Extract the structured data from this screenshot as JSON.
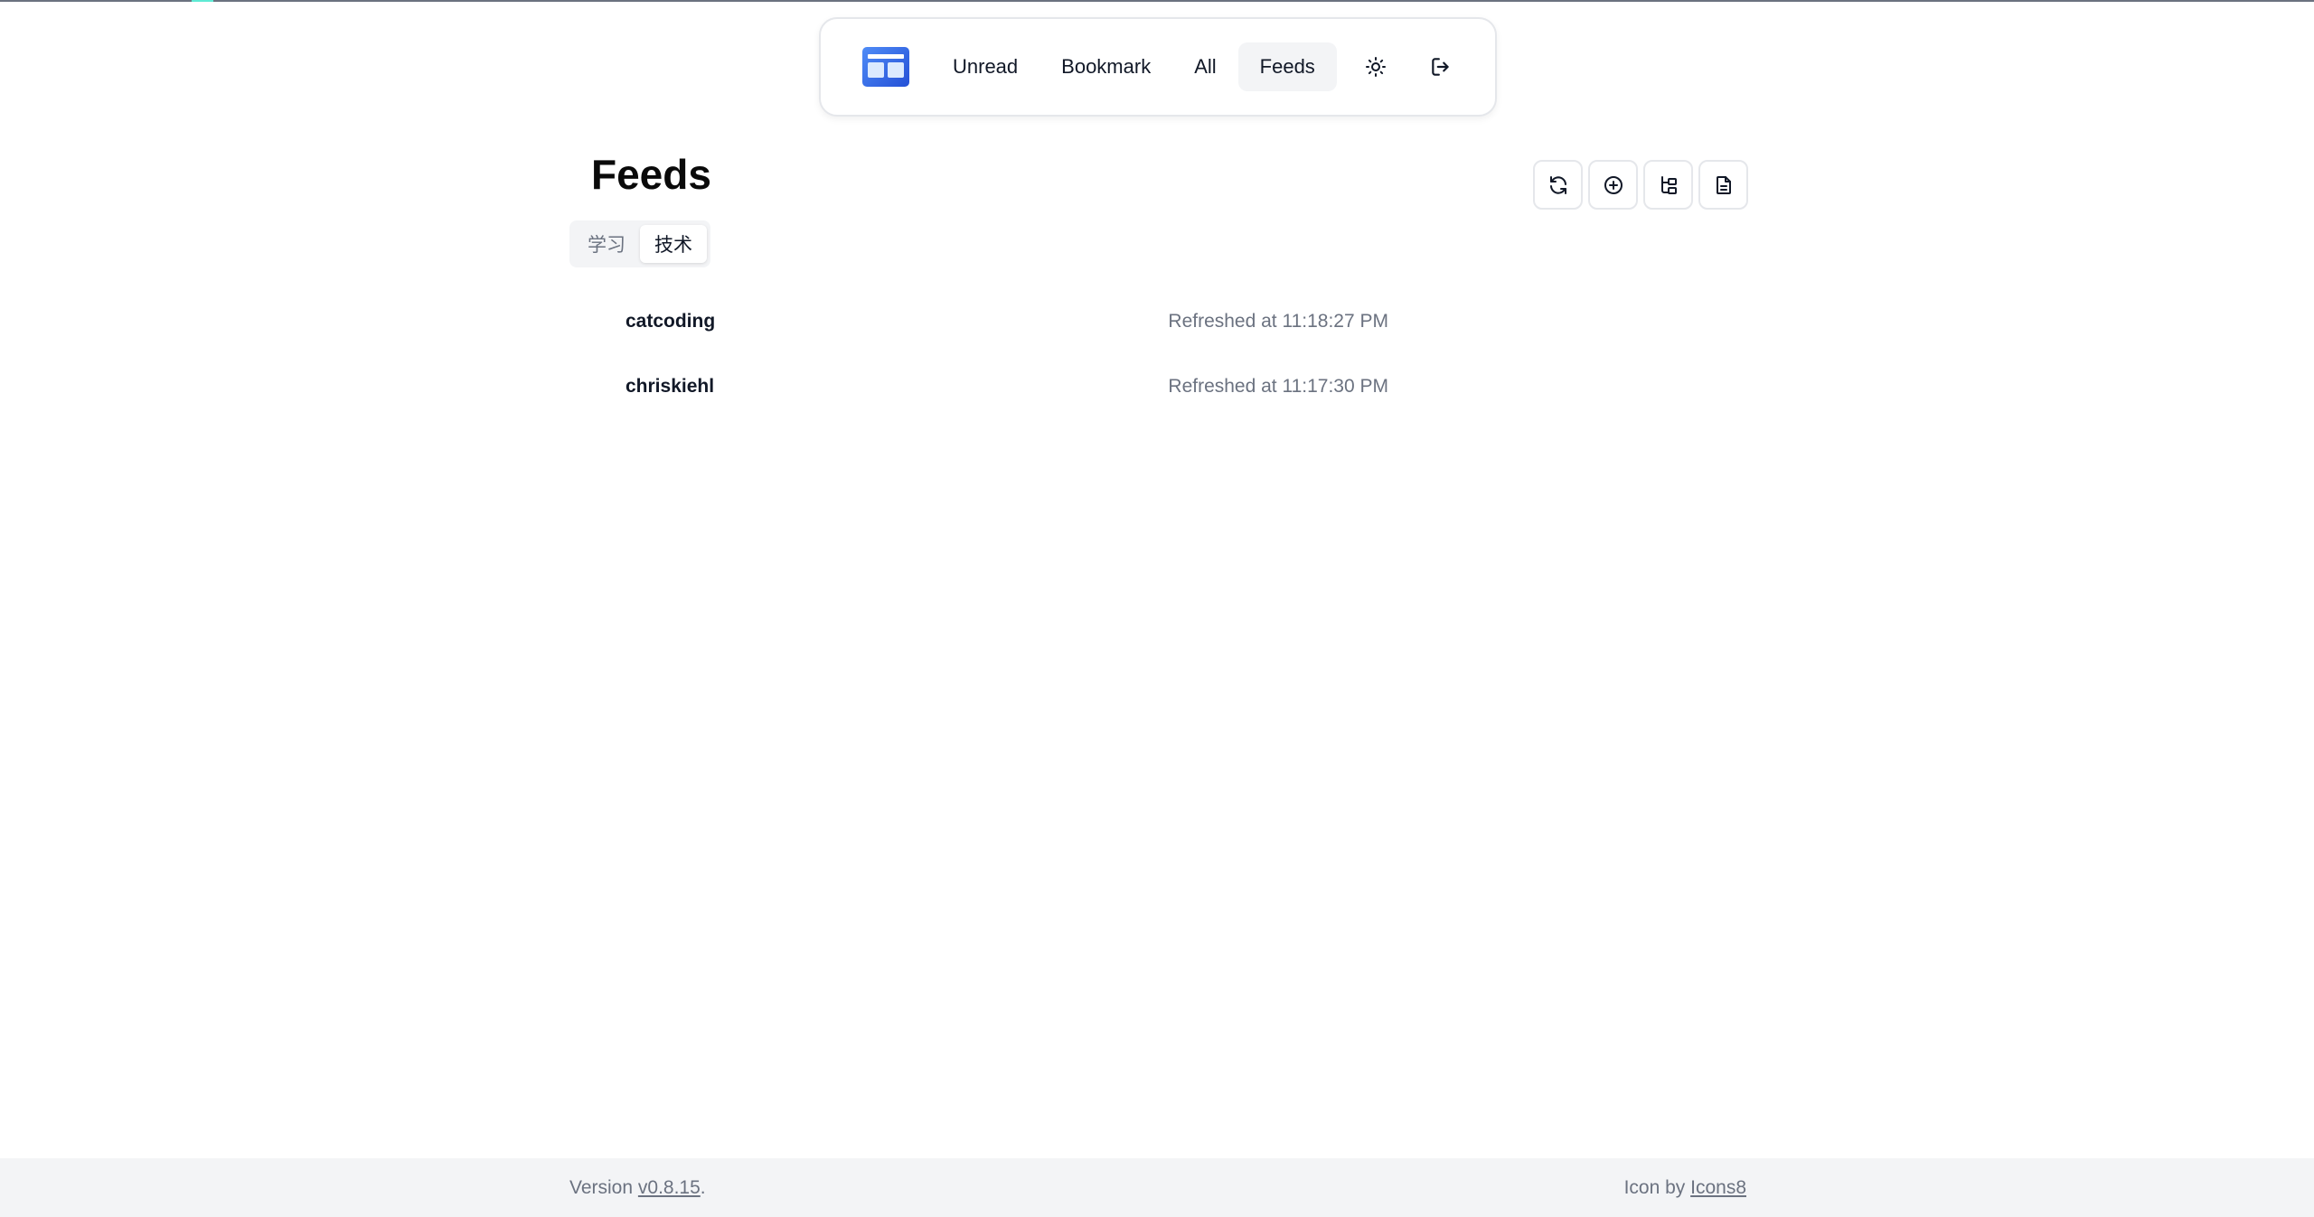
{
  "nav": {
    "logo": "app-logo",
    "items": [
      {
        "label": "Unread",
        "active": false
      },
      {
        "label": "Bookmark",
        "active": false
      },
      {
        "label": "All",
        "active": false
      },
      {
        "label": "Feeds",
        "active": true
      }
    ],
    "icons": [
      "sun-icon",
      "logout-icon"
    ]
  },
  "page": {
    "title": "Feeds",
    "toolbar": [
      "refresh-icon",
      "add-circle-icon",
      "folder-tree-icon",
      "document-icon"
    ]
  },
  "tabs": [
    {
      "label": "学习",
      "active": false
    },
    {
      "label": "技术",
      "active": true
    }
  ],
  "feeds": [
    {
      "name": "catcoding",
      "status": "Refreshed at 11:18:27 PM"
    },
    {
      "name": "chriskiehl",
      "status": "Refreshed at 11:17:30 PM"
    }
  ],
  "footer": {
    "version_prefix": "Version ",
    "version": "v0.8.15",
    "version_suffix": ".",
    "icon_prefix": "Icon by ",
    "icon_link": "Icons8"
  },
  "colors": {
    "accent": "#2450d6",
    "muted": "#6b7280",
    "active_bg": "#f3f4f6"
  }
}
